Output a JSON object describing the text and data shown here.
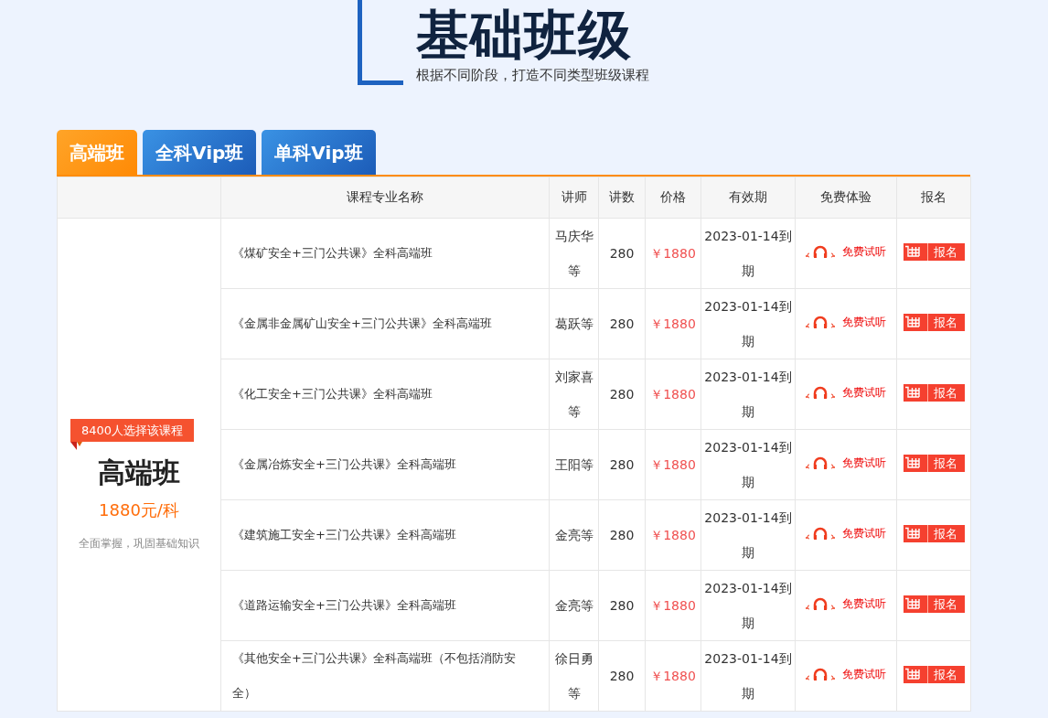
{
  "header": {
    "title": "基础班级",
    "subtitle": "根据不同阶段，打造不同类型班级课程"
  },
  "tabs": [
    {
      "label": "高端班",
      "selected": true
    },
    {
      "label": "全科Vip班",
      "selected": false
    },
    {
      "label": "单科Vip班",
      "selected": false
    }
  ],
  "table": {
    "columns": [
      "课程专业名称",
      "讲师",
      "讲数",
      "价格",
      "有效期",
      "免费体验",
      "报名"
    ],
    "summary": {
      "badge": "8400人选择该课程",
      "name": "高端班",
      "price": "1880元/科",
      "note": "全面掌握，巩固基础知识"
    },
    "rows": [
      {
        "name": "《煤矿安全+三门公共课》全科高端班",
        "teacher": "马庆华等",
        "lectures": "280",
        "price": "￥1880",
        "validity": "2023-01-14到期",
        "trial": "免费试听",
        "signup": "报名"
      },
      {
        "name": "《金属非金属矿山安全+三门公共课》全科高端班",
        "teacher": "葛跃等",
        "lectures": "280",
        "price": "￥1880",
        "validity": "2023-01-14到期",
        "trial": "免费试听",
        "signup": "报名"
      },
      {
        "name": "《化工安全+三门公共课》全科高端班",
        "teacher": "刘家喜等",
        "lectures": "280",
        "price": "￥1880",
        "validity": "2023-01-14到期",
        "trial": "免费试听",
        "signup": "报名"
      },
      {
        "name": "《金属冶炼安全+三门公共课》全科高端班",
        "teacher": "王阳等",
        "lectures": "280",
        "price": "￥1880",
        "validity": "2023-01-14到期",
        "trial": "免费试听",
        "signup": "报名"
      },
      {
        "name": "《建筑施工安全+三门公共课》全科高端班",
        "teacher": "金亮等",
        "lectures": "280",
        "price": "￥1880",
        "validity": "2023-01-14到期",
        "trial": "免费试听",
        "signup": "报名"
      },
      {
        "name": "《道路运输安全+三门公共课》全科高端班",
        "teacher": "金亮等",
        "lectures": "280",
        "price": "￥1880",
        "validity": "2023-01-14到期",
        "trial": "免费试听",
        "signup": "报名"
      },
      {
        "name": "《其他安全+三门公共课》全科高端班（不包括消防安全）",
        "teacher": "徐日勇等",
        "lectures": "280",
        "price": "￥1880",
        "validity": "2023-01-14到期",
        "trial": "免费试听",
        "signup": "报名"
      }
    ]
  }
}
